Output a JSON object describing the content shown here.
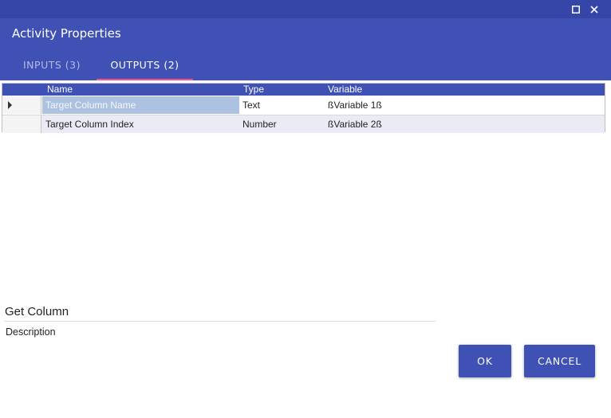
{
  "window": {
    "maximize_icon": "maximize-icon",
    "close_icon": "close-icon",
    "title": "Activity Properties"
  },
  "tabs": [
    {
      "label": "INPUTS (3)",
      "active": false
    },
    {
      "label": "OUTPUTS (2)",
      "active": true
    }
  ],
  "grid": {
    "columns": [
      "Name",
      "Type",
      "Variable"
    ],
    "rows": [
      {
        "name": "Target Column Name",
        "type": "Text",
        "variable": "ßVariable 1ß",
        "current": true
      },
      {
        "name": "Target Column Index",
        "type": "Number",
        "variable": "ßVariable 2ß",
        "current": false
      }
    ]
  },
  "activity": {
    "name": "Get Column",
    "description": "Description"
  },
  "buttons": {
    "ok": "OK",
    "cancel": "CANCEL"
  },
  "colors": {
    "primary": "#3f51b5",
    "titlebar": "#3545a8",
    "tab_indicator": "#ff4f8a",
    "selected_cell": "#adc2e0"
  }
}
